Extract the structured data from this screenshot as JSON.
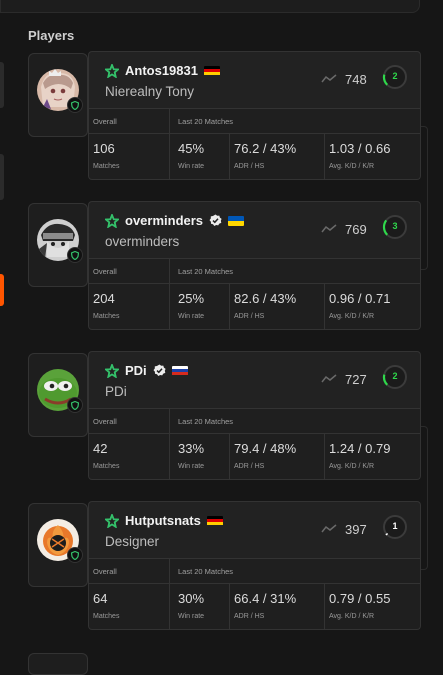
{
  "section_title": "Players",
  "headers": {
    "overall": "Overall",
    "last20": "Last 20 Matches"
  },
  "labels": {
    "matches": "Matches",
    "win_rate": "Win rate",
    "adr_hs": "ADR / HS",
    "kd_kr": "Avg. K/D / K/R"
  },
  "colors": {
    "accent": "#ff5500",
    "star": "#34c26b",
    "level_green": "#2fd84b",
    "level_white": "#ffffff"
  },
  "players": [
    {
      "nickname": "Antos19831",
      "display_name": "Nierealny Tony",
      "flag": "de",
      "verified": false,
      "elo": "748",
      "level": "2",
      "matches": "106",
      "win_rate": "45%",
      "adr_hs": "76.2 / 43%",
      "kd_kr": "1.03 / 0.66",
      "avatar": "anime-avatar-icon"
    },
    {
      "nickname": "overminders",
      "display_name": "overminders",
      "flag": "ua",
      "verified": true,
      "elo": "769",
      "level": "3",
      "matches": "204",
      "win_rate": "25%",
      "adr_hs": "82.6 / 43%",
      "kd_kr": "0.96 / 0.71",
      "avatar": "ninja-avatar-icon"
    },
    {
      "nickname": "PDi",
      "display_name": "PDi",
      "flag": "ru",
      "verified": true,
      "elo": "727",
      "level": "2",
      "matches": "42",
      "win_rate": "33%",
      "adr_hs": "79.4 / 48%",
      "kd_kr": "1.24 / 0.79",
      "avatar": "pepe-avatar-icon"
    },
    {
      "nickname": "Hutputsnats",
      "display_name": "Designer",
      "flag": "de",
      "verified": false,
      "elo": "397",
      "level": "1",
      "matches": "64",
      "win_rate": "30%",
      "adr_hs": "66.4 / 31%",
      "kd_kr": "0.79 / 0.55",
      "avatar": "flame-avatar-icon"
    }
  ]
}
